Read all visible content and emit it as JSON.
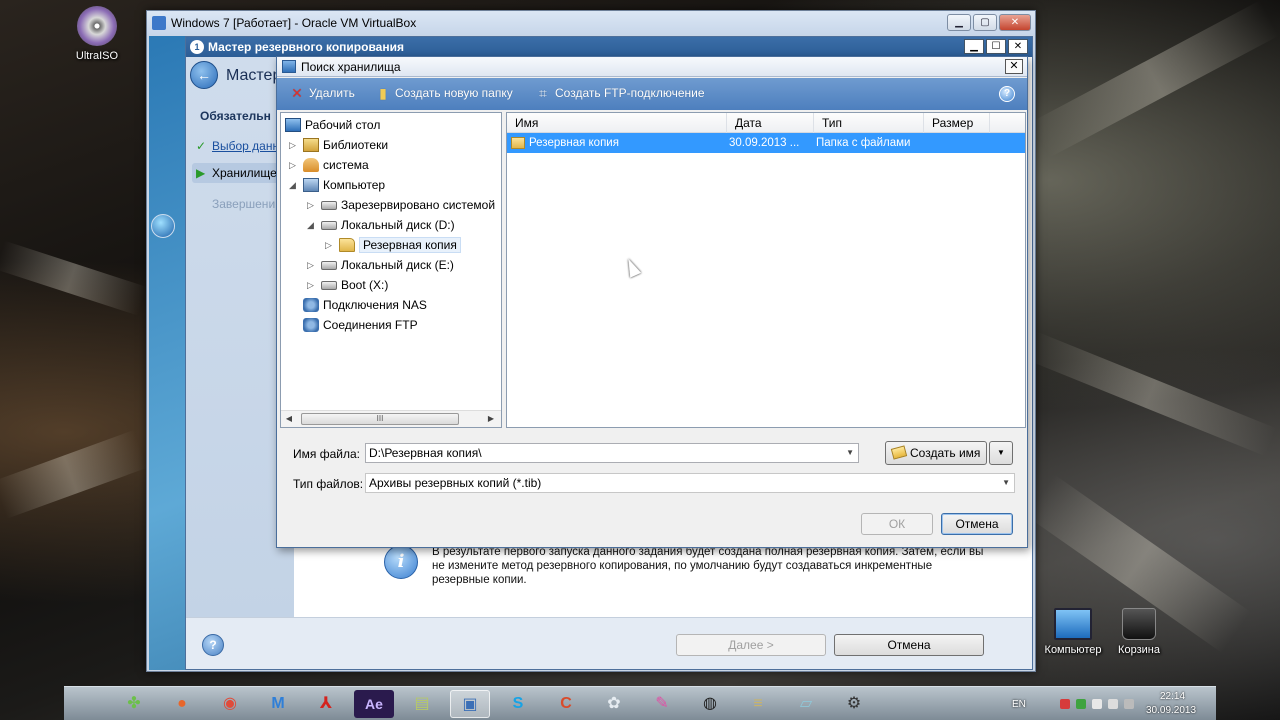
{
  "colors": {
    "selection": "#3399ff",
    "toolbar_blue": "#5b8cc8",
    "wizard_title": "#2c5d96"
  },
  "desktop": {
    "icons": [
      {
        "label": "UltraISO",
        "icon": "disc-icon"
      },
      {
        "label": "Компьютер",
        "icon": "computer-icon"
      },
      {
        "label": "Корзина",
        "icon": "recycle-bin-icon"
      }
    ]
  },
  "vbox": {
    "title": "Windows 7 [Работает] - Oracle VM VirtualBox",
    "minimize": "▁",
    "maximize": "▢",
    "close": "✕"
  },
  "wizard": {
    "title": "Мастер резервного копирования",
    "heading": "Мастер",
    "steps_header": "Обязательн",
    "steps": [
      {
        "label": "Выбор данн",
        "state": "done"
      },
      {
        "label": "Хранилище",
        "state": "current"
      },
      {
        "label": "Завершени",
        "state": "pending"
      }
    ],
    "info_text": "В результате первого запуска данного задания будет создана полная резервная копия. Затем, если вы не измените метод резервного копирования, по умолчанию будут создаваться инкрементные резервные копии.",
    "next_button": "Далее >",
    "cancel_button": "Отмена",
    "help": "?",
    "back_arrow": "←",
    "min": "▁",
    "max": "☐",
    "close": "✕"
  },
  "dialog": {
    "title": "Поиск хранилища",
    "close": "✕",
    "toolbar": {
      "delete": "Удалить",
      "new_folder": "Создать новую папку",
      "ftp": "Создать FTP-подключение",
      "help": "?"
    },
    "tree": [
      {
        "label": "Рабочий стол",
        "indent": 0,
        "icon": "desktop-icon",
        "expander": ""
      },
      {
        "label": "Библиотеки",
        "indent": 1,
        "icon": "libraries-icon",
        "expander": "▷"
      },
      {
        "label": "система",
        "indent": 1,
        "icon": "user-folder-icon",
        "expander": "▷"
      },
      {
        "label": "Компьютер",
        "indent": 1,
        "icon": "computer-icon",
        "expander": "◢"
      },
      {
        "label": "Зарезервировано системой",
        "indent": 2,
        "icon": "drive-icon",
        "expander": "▷"
      },
      {
        "label": "Локальный диск (D:)",
        "indent": 2,
        "icon": "drive-icon",
        "expander": "◢"
      },
      {
        "label": "Резервная копия",
        "indent": 3,
        "icon": "folder-icon",
        "expander": "▷",
        "selected": true
      },
      {
        "label": "Локальный диск (E:)",
        "indent": 2,
        "icon": "drive-icon",
        "expander": "▷"
      },
      {
        "label": "Boot (X:)",
        "indent": 2,
        "icon": "drive-icon",
        "expander": "▷"
      },
      {
        "label": "Подключения NAS",
        "indent": 1,
        "icon": "network-icon",
        "expander": ""
      },
      {
        "label": "Соединения FTP",
        "indent": 1,
        "icon": "network-icon",
        "expander": ""
      }
    ],
    "scroll_thumb": "III",
    "columns": [
      "Имя",
      "Дата",
      "Тип",
      "Размер"
    ],
    "rows": [
      {
        "name": "Резервная копия",
        "date": "30.09.2013 ...",
        "type": "Папка с файлами",
        "size": ""
      }
    ],
    "filename_label": "Имя файла:",
    "filename_value": "D:\\Резервная копия\\",
    "filetype_label": "Тип файлов:",
    "filetype_value": "Архивы резервных копий (*.tib)",
    "create_name_button": "Создать имя",
    "ok_button": "ОК",
    "cancel_button": "Отмена"
  },
  "taskbar": {
    "apps": [
      {
        "icon": "clover-icon",
        "glyph": "✤",
        "color": "#6cc04a"
      },
      {
        "icon": "firefox-icon",
        "glyph": "●",
        "color": "#e8662a"
      },
      {
        "icon": "chrome-icon",
        "glyph": "◉",
        "color": "#e04b3a"
      },
      {
        "icon": "maxthon-icon",
        "glyph": "M",
        "color": "#2f7fd8"
      },
      {
        "icon": "acrobat-icon",
        "glyph": "⅄",
        "color": "#d4231e"
      },
      {
        "icon": "after-effects-icon",
        "glyph": "Ae",
        "color": "#2a1a4d"
      },
      {
        "icon": "notepad-icon",
        "glyph": "▤",
        "color": "#b5c86a"
      },
      {
        "icon": "virtualbox-icon",
        "glyph": "▣",
        "color": "#3b6fb6"
      },
      {
        "icon": "skype-icon",
        "glyph": "S",
        "color": "#16a3e6"
      },
      {
        "icon": "ccleaner-icon",
        "glyph": "C",
        "color": "#d94b2a"
      },
      {
        "icon": "tool-icon",
        "glyph": "✿",
        "color": "#9aa7b3"
      },
      {
        "icon": "pen-icon",
        "glyph": "✎",
        "color": "#e14fa5"
      },
      {
        "icon": "media-icon",
        "glyph": "◍",
        "color": "#333333"
      },
      {
        "icon": "stack-icon",
        "glyph": "≡",
        "color": "#c8b36a"
      },
      {
        "icon": "image-icon",
        "glyph": "▱",
        "color": "#8fc7d8"
      },
      {
        "icon": "usb-icon",
        "glyph": "⚙",
        "color": "#444444"
      }
    ],
    "language": "EN",
    "time": "22:14",
    "date": "30.09.2013"
  }
}
